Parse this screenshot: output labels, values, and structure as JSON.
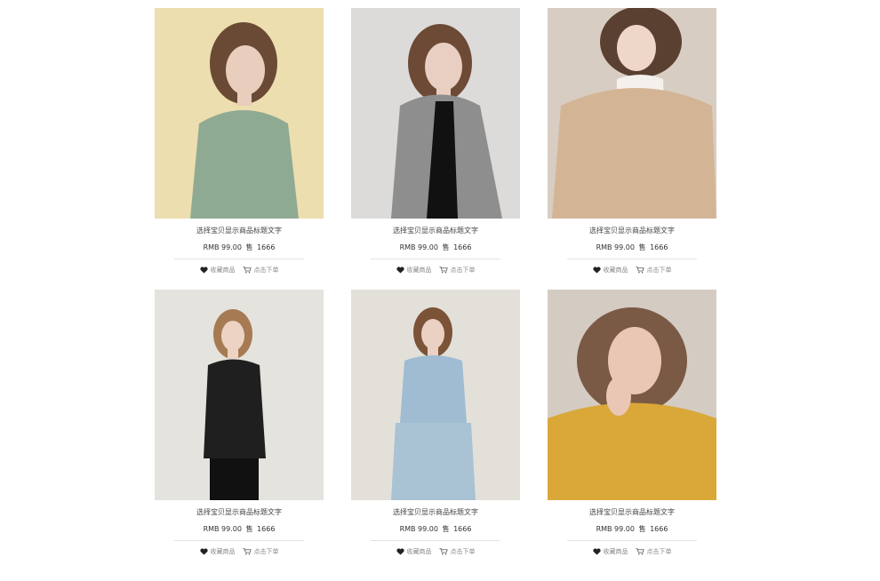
{
  "products": [
    {
      "title": "选择宝贝显示商品标题文字",
      "price": "RMB 99.00",
      "sold_label": "售",
      "sold": "1666",
      "fav_label": "收藏商品",
      "order_label": "点击下单",
      "colors": {
        "bg": "#ead9a8",
        "bg2": "#f2e4b8",
        "cloth": "#8faa92",
        "hair": "#6a4a35",
        "skin": "#e9cdbd"
      }
    },
    {
      "title": "选择宝贝显示商品标题文字",
      "price": "RMB 99.00",
      "sold_label": "售",
      "sold": "1666",
      "fav_label": "收藏商品",
      "order_label": "点击下单",
      "colors": {
        "bg": "#d4d3d1",
        "bg2": "#e6e5e3",
        "cloth": "#8e8e8e",
        "hair": "#6d4a35",
        "skin": "#e8cfc2"
      }
    },
    {
      "title": "选择宝贝显示商品标题文字",
      "price": "RMB 99.00",
      "sold_label": "售",
      "sold": "1666",
      "fav_label": "收藏商品",
      "order_label": "点击下单",
      "colors": {
        "bg": "#cfc5ba",
        "bg2": "#e2d8cc",
        "cloth": "#d3b595",
        "hair": "#5a4030",
        "skin": "#eed6c8"
      }
    },
    {
      "title": "选择宝贝显示商品标题文字",
      "price": "RMB 99.00",
      "sold_label": "售",
      "sold": "1666",
      "fav_label": "收藏商品",
      "order_label": "点击下单",
      "colors": {
        "bg": "#dedcd8",
        "bg2": "#eceae6",
        "cloth": "#1f1f1f",
        "hair": "#a67a52",
        "skin": "#ecd3c4"
      }
    },
    {
      "title": "选择宝贝显示商品标题文字",
      "price": "RMB 99.00",
      "sold_label": "售",
      "sold": "1666",
      "fav_label": "收藏商品",
      "order_label": "点击下单",
      "colors": {
        "bg": "#dcd9d4",
        "bg2": "#ebe8e3",
        "cloth": "#9fbcd2",
        "hair": "#7b5336",
        "skin": "#ead1c3"
      }
    },
    {
      "title": "选择宝贝显示商品标题文字",
      "price": "RMB 99.00",
      "sold_label": "售",
      "sold": "1666",
      "fav_label": "收藏商品",
      "order_label": "点击下单",
      "colors": {
        "bg": "#c8bfb6",
        "bg2": "#e2dad2",
        "cloth": "#d9a838",
        "hair": "#7a5a44",
        "skin": "#eac7b4"
      }
    }
  ],
  "colors": {
    "heart": "#222222",
    "muted": "#888888",
    "divider": "#e3e3e3"
  }
}
